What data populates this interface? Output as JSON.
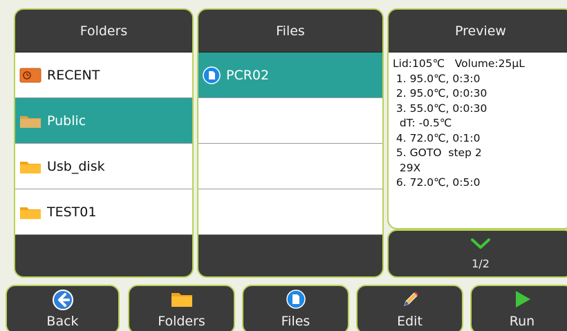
{
  "panels": {
    "folders": {
      "title": "Folders",
      "items": [
        {
          "label": "RECENT",
          "icon": "recent-icon"
        },
        {
          "label": "Public",
          "icon": "folder-icon",
          "selected": true
        },
        {
          "label": "Usb_disk",
          "icon": "folder-icon"
        },
        {
          "label": "TEST01",
          "icon": "folder-icon"
        }
      ]
    },
    "files": {
      "title": "Files",
      "items": [
        {
          "label": "PCR02",
          "icon": "file-icon",
          "selected": true
        }
      ]
    },
    "preview": {
      "title": "Preview",
      "lines": [
        "Lid:105℃   Volume:25μL",
        " 1. 95.0℃, 0:3:0",
        " 2. 95.0℃, 0:0:30",
        " 3. 55.0℃, 0:0:30",
        "  dT: -0.5℃",
        " 4. 72.0℃, 0:1:0",
        " 5. GOTO  step 2",
        "  29X",
        " 6. 72.0℃, 0:5:0"
      ],
      "page": "1/2"
    }
  },
  "toolbar": {
    "back": "Back",
    "folders": "Folders",
    "files": "Files",
    "edit": "Edit",
    "run": "Run"
  },
  "colors": {
    "accent": "#b9d25a",
    "selected": "#2aa198",
    "panel": "#3b3b3b"
  }
}
